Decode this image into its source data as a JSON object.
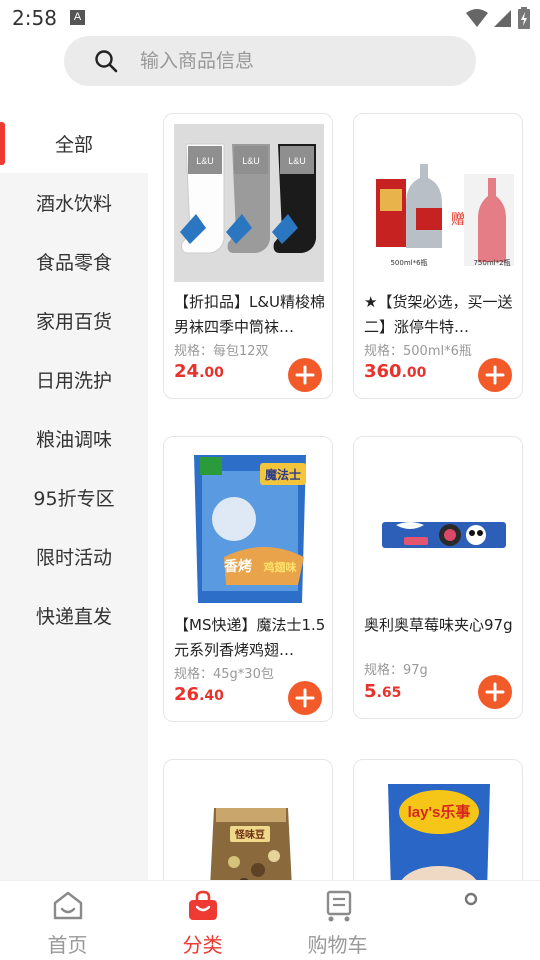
{
  "status_bar": {
    "time": "2:58",
    "badge": "A"
  },
  "search": {
    "placeholder": "输入商品信息"
  },
  "sidebar": {
    "active_index": 0,
    "items": [
      {
        "label": "全部"
      },
      {
        "label": "酒水饮料"
      },
      {
        "label": "食品零食"
      },
      {
        "label": "家用百货"
      },
      {
        "label": "日用洗护"
      },
      {
        "label": "粮油调味"
      },
      {
        "label": "95折专区"
      },
      {
        "label": "限时活动"
      },
      {
        "label": "快递直发"
      }
    ]
  },
  "products": [
    {
      "title": "【折扣品】L&U精梭棉男袜四季中筒袜…",
      "spec": "规格：每包12双",
      "price_int": "24",
      "price_dec": ".00",
      "image_labels": [
        "L&U",
        "L&U",
        "L&U"
      ]
    },
    {
      "title": "★【货架必选，买一送二】涨停牛特…",
      "spec": "规格：500ml*6瓶",
      "price_int": "360",
      "price_dec": ".00",
      "image_labels": [
        "赠",
        "500ml*6瓶",
        "750ml*2瓶"
      ]
    },
    {
      "title": "【MS快递】魔法士1.5元系列香烤鸡翅…",
      "spec": "规格：45g*30包",
      "price_int": "26",
      "price_dec": ".40",
      "image_labels": [
        "魔法士",
        "香烤",
        "鸡翅味"
      ]
    },
    {
      "title": "奥利奥草莓味夹心97g",
      "spec": "规格：97g",
      "price_int": "5",
      "price_dec": ".65",
      "image_labels": []
    },
    {
      "title": "",
      "spec": "",
      "price_int": "",
      "price_dec": "",
      "image_labels": [
        "怪味豆"
      ]
    },
    {
      "title": "",
      "spec": "",
      "price_int": "",
      "price_dec": "",
      "image_labels": [
        "lay's乐事"
      ]
    }
  ],
  "tabs": [
    {
      "label": "首页",
      "icon": "home-icon"
    },
    {
      "label": "分类",
      "icon": "bag-icon"
    },
    {
      "label": "购物车",
      "icon": "cart-icon"
    }
  ],
  "colors": {
    "accent": "#ee3a32",
    "add_button": "#f25a2a",
    "sidebar_bg": "#f5f5f5"
  }
}
